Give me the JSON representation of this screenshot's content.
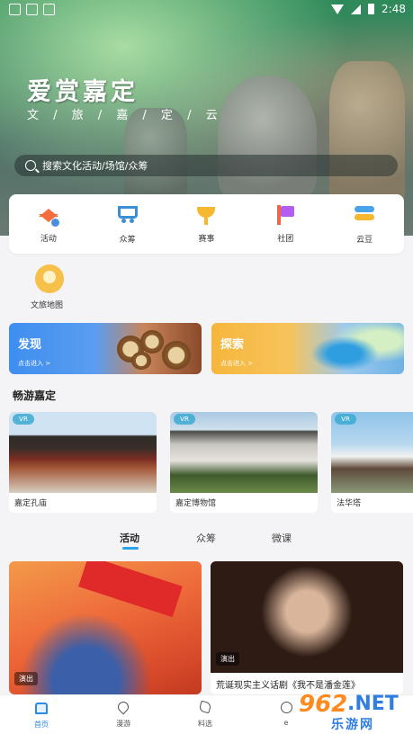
{
  "status_bar": {
    "time": "2:48"
  },
  "hero": {
    "title": "爱赏嘉定",
    "subtitle": "文 / 旅 / 嘉 / 定 / 云"
  },
  "search": {
    "placeholder": "搜索文化活动/场馆/众筹"
  },
  "quick_nav": [
    {
      "label": "活动",
      "icon": "star-icon"
    },
    {
      "label": "众筹",
      "icon": "cart-icon"
    },
    {
      "label": "赛事",
      "icon": "trophy-icon"
    },
    {
      "label": "社团",
      "icon": "flag-icon"
    },
    {
      "label": "云豆",
      "icon": "coin-stack-icon"
    }
  ],
  "culture_map": {
    "label": "文旅地图"
  },
  "banners": {
    "discover": {
      "title": "发现",
      "sub": "点击进入 >"
    },
    "explore": {
      "title": "探索",
      "sub": "点击进入 >"
    }
  },
  "section_title": "畅游嘉定",
  "vr_cards": [
    {
      "badge": "VR",
      "name": "嘉定孔庙"
    },
    {
      "badge": "VR",
      "name": "嘉定博物馆"
    },
    {
      "badge": "VR",
      "name": "法华塔"
    }
  ],
  "tabs": [
    "活动",
    "众筹",
    "微课"
  ],
  "activities": [
    {
      "tag": "演出",
      "title": ""
    },
    {
      "tag": "演出",
      "title": "荒诞现实主义话剧《我不是潘金莲》"
    }
  ],
  "bottom_nav": [
    {
      "label": "首页",
      "icon": "home-icon"
    },
    {
      "label": "漫游",
      "icon": "location-pin-icon"
    },
    {
      "label": "料选",
      "icon": "tag-icon"
    },
    {
      "label": "e",
      "icon": "user-icon"
    }
  ],
  "watermark": {
    "num": "962",
    "net": ".NET",
    "cn": "乐游网"
  },
  "colors": {
    "accent": "#2a8be6",
    "discover": "#3e8ef0",
    "explore": "#f6b63c"
  }
}
